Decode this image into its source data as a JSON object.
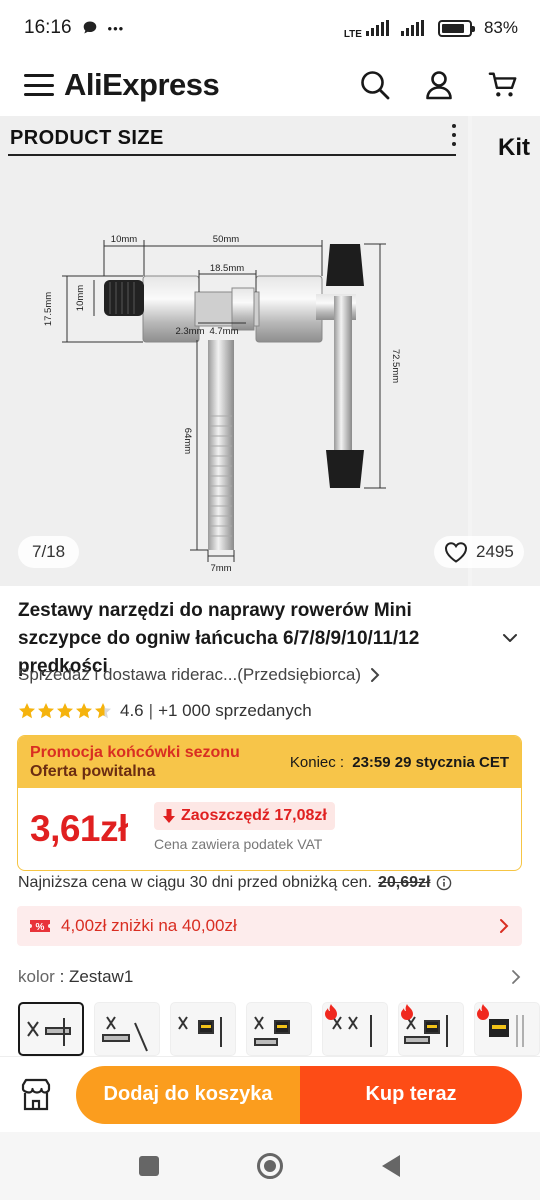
{
  "status_bar": {
    "time": "16:16",
    "dots": "•••",
    "network": "LTE",
    "battery_percent": "83%",
    "battery_level": 0.83
  },
  "header": {
    "logo_text": "AliExpress"
  },
  "gallery": {
    "heading": "PRODUCT SIZE",
    "next_slide_text": "Kit",
    "counter": "7/18",
    "wishlist_count": "2495",
    "dims": {
      "d10mm": "10mm",
      "d50mm": "50mm",
      "d18_5mm": "18.5mm",
      "d17_5mm": "17.5mm",
      "d10mm_v": "10mm",
      "d2_3mm": "2.3mm",
      "d4_7mm": "4.7mm",
      "d72_5mm": "72.5mm",
      "d64mm": "64mm",
      "d7mm": "7mm"
    }
  },
  "product": {
    "title": "Zestawy narzędzi do naprawy rowerów Mini szczypce do ogniw łańcucha 6/7/8/9/10/11/12 prędkości",
    "seller": "Sprzedaż i dostawa riderac...(Przedsiębiorca)",
    "rating": "4.6",
    "sold": "+1 000 sprzedanych",
    "stars_value": 4.6
  },
  "promo": {
    "title1": "Promocja końcówki sezonu",
    "title2": "Oferta powitalna",
    "end_label": "Koniec :",
    "end_time": "23:59 29 stycznia CET",
    "price": "3,61zł",
    "save": "Zaoszczędź 17,08zł",
    "vat": "Cena zawiera podatek VAT"
  },
  "lowest_price": {
    "label": "Najniższa cena w ciągu 30 dni przed obniżką cen.",
    "value": "20,69zł"
  },
  "coupon": {
    "text": "4,00zł zniżki na 40,00zł"
  },
  "variant": {
    "label": "kolor",
    "sep": " : ",
    "value": "Zestaw1"
  },
  "actions": {
    "add_to_cart": "Dodaj do koszyka",
    "buy_now": "Kup teraz"
  },
  "colors": {
    "brand_red": "#e02020",
    "cart_orange": "#fb9d1e",
    "buy_orange": "#fd4c16",
    "promo_yellow": "#f7c549"
  }
}
